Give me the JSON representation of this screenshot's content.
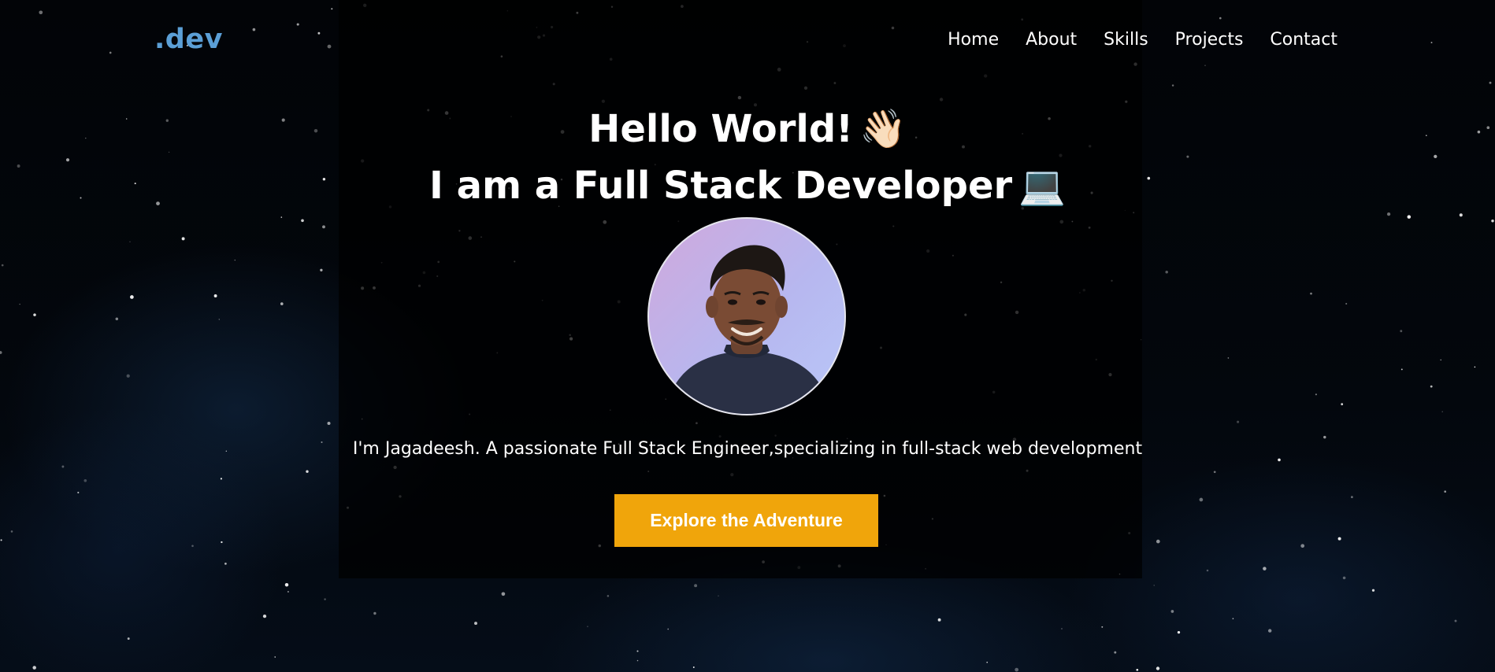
{
  "header": {
    "logo": ".dev",
    "nav": [
      {
        "label": "Home"
      },
      {
        "label": "About"
      },
      {
        "label": "Skills"
      },
      {
        "label": "Projects"
      },
      {
        "label": "Contact"
      }
    ]
  },
  "hero": {
    "greeting": "Hello World!",
    "greeting_emoji": "👋🏻",
    "role": "I am a Full Stack Developer",
    "role_emoji": "💻",
    "intro": "I'm Jagadeesh. A passionate Full Stack Engineer,specializing in full-stack web development",
    "cta_label": "Explore the Adventure"
  },
  "colors": {
    "accent": "#f0a50b",
    "logo": "#5b9fd6",
    "background": "#000000"
  }
}
